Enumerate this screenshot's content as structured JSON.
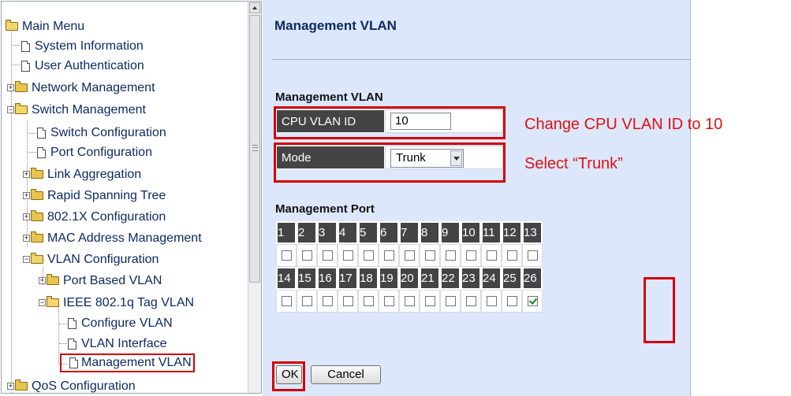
{
  "nav": {
    "items": [
      {
        "label": "Main Menu"
      },
      {
        "label": "System Information"
      },
      {
        "label": "User Authentication"
      },
      {
        "label": "Network Management"
      },
      {
        "label": "Switch Management"
      },
      {
        "label": "Switch Configuration"
      },
      {
        "label": "Port Configuration"
      },
      {
        "label": "Link Aggregation"
      },
      {
        "label": "Rapid Spanning Tree"
      },
      {
        "label": "802.1X Configuration"
      },
      {
        "label": "MAC Address Management"
      },
      {
        "label": "VLAN Configuration"
      },
      {
        "label": "Port Based VLAN"
      },
      {
        "label": "IEEE 802.1q Tag VLAN"
      },
      {
        "label": "Configure VLAN"
      },
      {
        "label": "VLAN Interface"
      },
      {
        "label": "Management VLAN"
      },
      {
        "label": "QoS Configuration"
      }
    ],
    "selected": "Management VLAN"
  },
  "page": {
    "title": "Management VLAN",
    "section_vlan": "Management VLAN",
    "cpu_vlan_id_label": "CPU VLAN ID",
    "cpu_vlan_id_value": "10",
    "mode_label": "Mode",
    "mode_value": "Trunk",
    "section_port": "Management Port",
    "ports_row1": [
      "1",
      "2",
      "3",
      "4",
      "5",
      "6",
      "7",
      "8",
      "9",
      "10",
      "11",
      "12",
      "13"
    ],
    "ports_row2": [
      "14",
      "15",
      "16",
      "17",
      "18",
      "19",
      "20",
      "21",
      "22",
      "23",
      "24",
      "25",
      "26"
    ],
    "checked_ports": [
      "26"
    ],
    "ok_label": "OK",
    "cancel_label": "Cancel"
  },
  "annotations": {
    "note_vlan_id": "Change CPU VLAN ID to 10",
    "note_mode": "Select “Trunk”",
    "highlight_color": "#d40000"
  }
}
